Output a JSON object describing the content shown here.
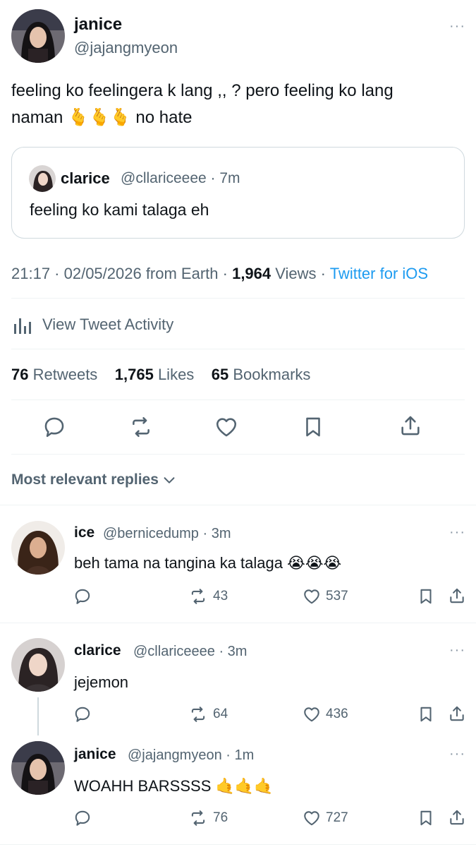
{
  "tweet": {
    "author_name": "janice",
    "author_handle": "@jajangmyeon",
    "text_line1": "feeling ko feelingera k lang ,, ? pero feeling ko lang",
    "text_line2_start": "naman",
    "text_emoji": "🫰🫰🫰",
    "text_line2_end": "no hate",
    "quote": {
      "author_name": "clarice",
      "author_meta": "@cllariceeee · 7m",
      "text": "feeling ko kami talaga eh"
    },
    "time": "21:17 · 02/05/2026 from Earth · ",
    "views_count": "1,964",
    "views_label": " Views · ",
    "client": "Twitter for iOS",
    "activity_label": "View Tweet Activity",
    "retweets_count": "76",
    "retweets_label": " Retweets",
    "likes_count": "1,765",
    "likes_label": " Likes",
    "bookmarks_count": "65",
    "bookmarks_label": " Bookmarks"
  },
  "replies_header": "Most relevant replies",
  "replies": [
    {
      "name": "ice",
      "meta": "@bernicedump · 3m",
      "text": "beh tama na tangina ka talaga",
      "emoji": "😭😭😭",
      "retweets": "43",
      "likes": "537"
    },
    {
      "name": "clarice",
      "meta": "@cllariceeee · 3m",
      "text": "jejemon",
      "emoji": "",
      "retweets": "64",
      "likes": "436"
    },
    {
      "name": "janice",
      "meta": "@jajangmyeon · 1m",
      "text": "WOAHH BARSSSS",
      "emoji": "🤙🤙🤙",
      "retweets": "76",
      "likes": "727"
    }
  ],
  "more_glyph": "···",
  "colors": {
    "text": "#0f1419",
    "secondary": "#536471",
    "link": "#1d9bf0",
    "divider": "#eff3f4",
    "border": "#cfd9de"
  }
}
